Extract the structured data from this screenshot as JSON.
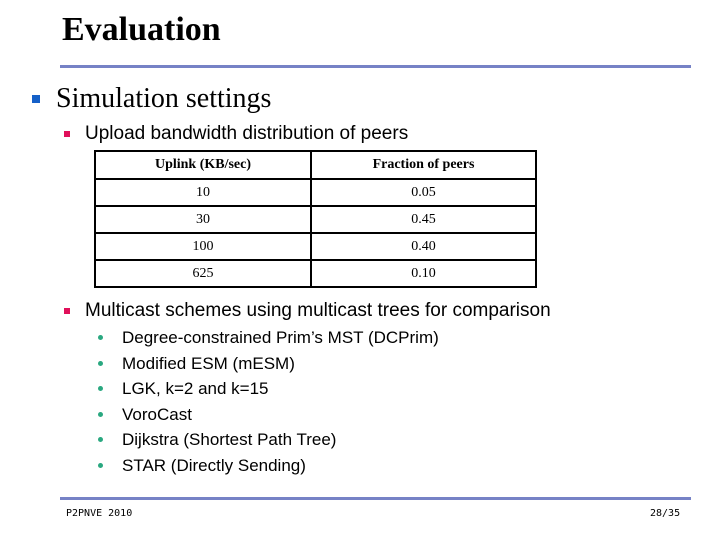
{
  "slide": {
    "title": "Evaluation",
    "accent_line_color": "#7682c6",
    "level1": {
      "text": "Simulation settings",
      "bullet_color": "#1560c8"
    },
    "bandwidth_section": {
      "text": "Upload bandwidth distribution of peers",
      "bullet_color": "#e0105a",
      "table": {
        "headers": [
          "Uplink (KB/sec)",
          "Fraction of peers"
        ],
        "rows": [
          [
            "10",
            "0.05"
          ],
          [
            "30",
            "0.45"
          ],
          [
            "100",
            "0.40"
          ],
          [
            "625",
            "0.10"
          ]
        ]
      }
    },
    "multicast_section": {
      "text": "Multicast schemes using multicast trees for comparison",
      "bullet_color": "#e0105a",
      "items": [
        "Degree-constrained Prim’s MST (DCPrim)",
        "Modified ESM (mESM)",
        "LGK, k=2 and k=15",
        "VoroCast",
        "Dijkstra (Shortest Path Tree)",
        "STAR (Directly Sending)"
      ]
    },
    "footer": {
      "left": "P2PNVE 2010",
      "right": "28/35"
    }
  }
}
